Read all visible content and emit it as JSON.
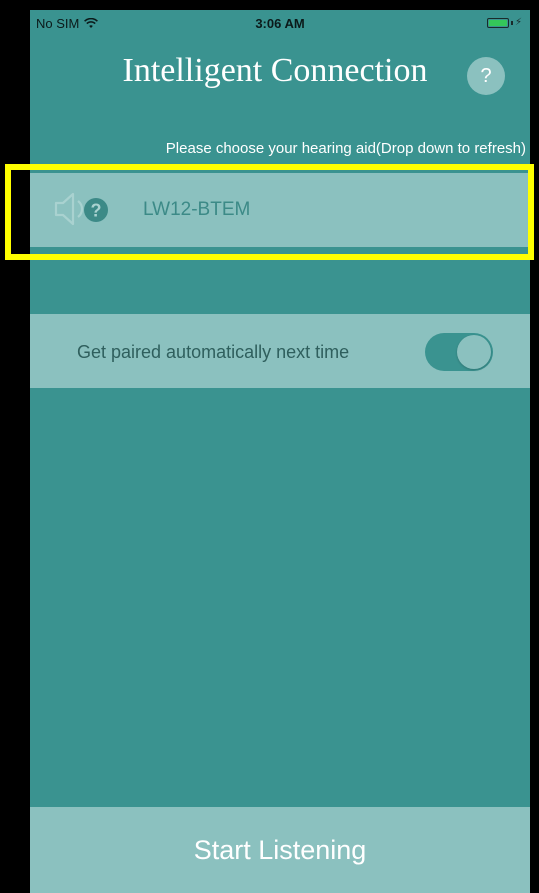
{
  "status_bar": {
    "carrier": "No SIM",
    "time": "3:06 AM",
    "icons": [
      "wifi-icon",
      "battery-icon",
      "charging-bolt-icon"
    ]
  },
  "header": {
    "title": "Intelligent Connection",
    "help_label": "?"
  },
  "instruction": "Please choose your hearing aid(Drop down to refresh)",
  "device_list": [
    {
      "name": "LW12-BTEM",
      "icon": "speaker-question-icon"
    }
  ],
  "auto_pair": {
    "label": "Get paired automatically next time",
    "enabled": true
  },
  "start_button": {
    "label": "Start Listening"
  },
  "colors": {
    "background": "#3a9390",
    "row": "#8bc1bf",
    "highlight": "#ffff00",
    "frame": "#000000"
  }
}
